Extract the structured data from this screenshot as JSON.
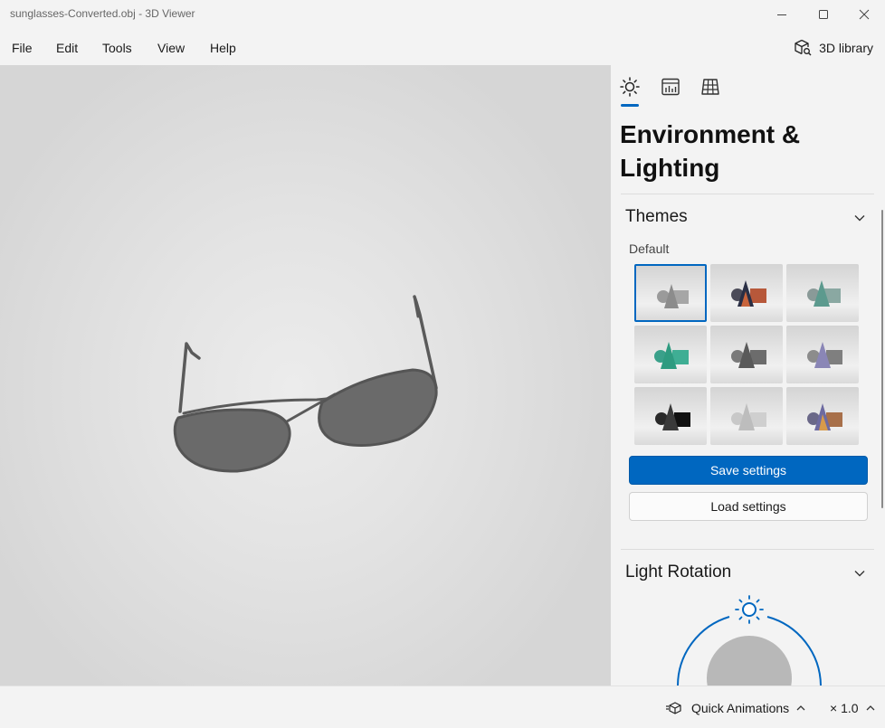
{
  "window": {
    "title": "sunglasses-Converted.obj - 3D Viewer",
    "minimize_icon": "minimize-icon",
    "maximize_icon": "maximize-icon",
    "close_icon": "close-icon"
  },
  "menu": {
    "items": [
      "File",
      "Edit",
      "Tools",
      "View",
      "Help"
    ],
    "library_label": "3D library",
    "library_icon": "cube-search-icon"
  },
  "viewport": {
    "model": "sunglasses"
  },
  "panel": {
    "tabs": [
      {
        "icon": "sun-icon",
        "selected": true
      },
      {
        "icon": "stats-icon",
        "selected": false
      },
      {
        "icon": "grid-icon",
        "selected": false
      }
    ],
    "title": "Environment & Lighting",
    "themes": {
      "heading": "Themes",
      "selected_label": "Default",
      "save_label": "Save settings",
      "load_label": "Load settings",
      "accent": "#0067c0"
    },
    "light_rotation": {
      "heading": "Light Rotation"
    }
  },
  "status": {
    "quick_animations_label": "Quick Animations",
    "speed": "× 1.0"
  }
}
